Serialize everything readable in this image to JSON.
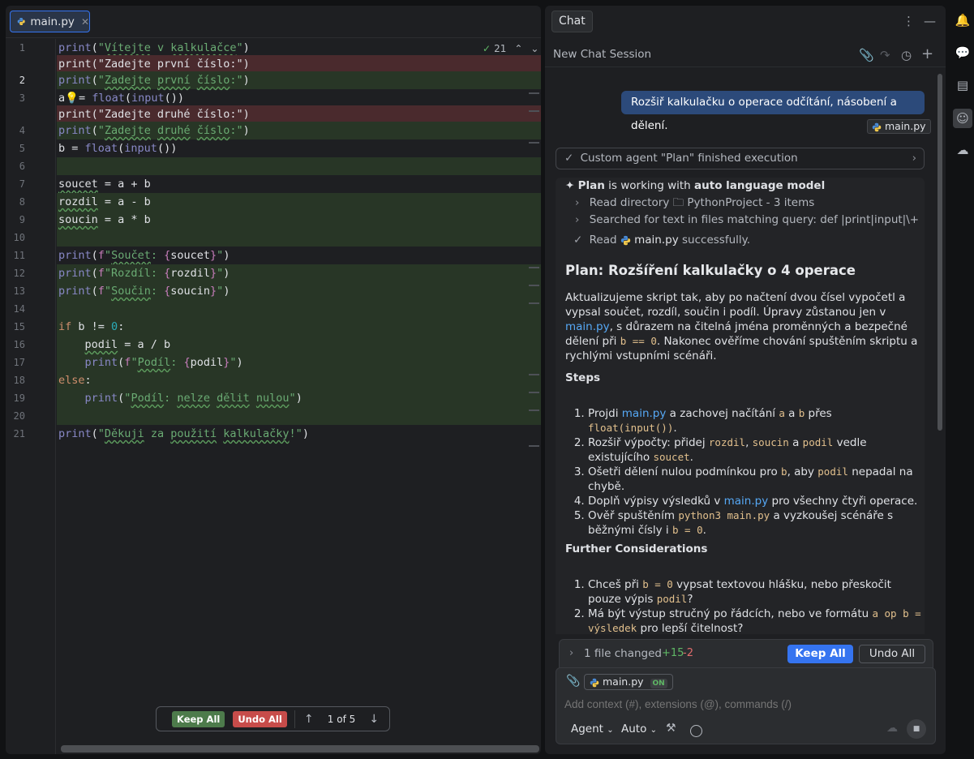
{
  "editor": {
    "tab_label": "main.py",
    "diff_count": "21",
    "line_numbers": [
      "1",
      "2",
      "3",
      "4",
      "5",
      "6",
      "7",
      "8",
      "9",
      "10",
      "11",
      "12",
      "13",
      "14",
      "15",
      "16",
      "17",
      "18",
      "19",
      "20",
      "21"
    ],
    "floating": {
      "keep_all": "Keep All",
      "undo_all": "Undo All",
      "position": "1 of 5"
    }
  },
  "chat": {
    "tab_label": "Chat",
    "session_title": "New Chat Session",
    "user_message": "Rozšiř kalkulačku o operace odčítání, násobení a dělení.",
    "user_attachment": "main.py",
    "agent_status": "Custom agent \"Plan\" finished execution",
    "plan_header": {
      "name": "Plan",
      "mid": "is working with",
      "model": "auto language model"
    },
    "tools": {
      "read_dir_label": "Read directory",
      "read_dir_target": "PythonProject - 3 items",
      "search_label": "Searched for text in files matching query: def |print|input|\\+",
      "read_label": "Read",
      "read_file": "main.py",
      "read_suffix": "successfully."
    },
    "plan_title": "Plan: Rozšíření kalkulačky o 4 operace",
    "intro": {
      "a": "Aktualizujeme skript tak, aby po načtení dvou čísel vypočetl a vypsal součet, rozdíl, součin i podíl. Úpravy zůstanou jen v ",
      "link": "main.py",
      "b": ", s důrazem na čitelná jména proměnných a bezpečné dělení při ",
      "code": "b == 0",
      "c": ". Nakonec ověříme chování spuštěním skriptu a rychlými vstupními scénáři."
    },
    "steps_heading": "Steps",
    "steps": {
      "s1": {
        "a": "Projdi ",
        "link": "main.py",
        "b": " a zachovej načítání ",
        "c1": "a",
        "b2": " a ",
        "c2": "b",
        "b3": " přes ",
        "c3": "float(input())",
        "end": "."
      },
      "s2": {
        "a": "Rozšiř výpočty: přidej ",
        "c1": "rozdil",
        "b": ", ",
        "c2": "soucin",
        "b2": " a ",
        "c3": "podil",
        "b3": " vedle existujícího ",
        "c4": "soucet",
        "end": "."
      },
      "s3": {
        "a": "Ošetři dělení nulou podmínkou pro ",
        "c1": "b",
        "b": ", aby ",
        "c2": "podil",
        "end": " nepadal na chybě."
      },
      "s4": {
        "a": "Doplň výpisy výsledků v ",
        "link": "main.py",
        "end": " pro všechny čtyři operace."
      },
      "s5": {
        "a": "Ověř spuštěním ",
        "c1": "python3 main.py",
        "b": " a vyzkoušej scénáře s běžnými čísly i ",
        "c2": "b = 0",
        "end": "."
      }
    },
    "further_heading": "Further Considerations",
    "further": {
      "f1": {
        "a": "Chceš při ",
        "c1": "b = 0",
        "b": " vypsat textovou hlášku, nebo přeskočit pouze výpis ",
        "c2": "podil",
        "end": "?"
      },
      "f2": {
        "a": "Má být výstup stručný po řádcích, nebo ve formátu ",
        "c1": "a op b = výsledek",
        "end": " pro lepší čitelnost?"
      }
    },
    "changes": {
      "summary": "1 file changed",
      "added": "+15",
      "removed": "-2",
      "keep_all": "Keep All",
      "undo_all": "Undo All"
    },
    "composer": {
      "context_file": "main.py",
      "context_toggle": "ON",
      "placeholder": "Add context (#), extensions (@), commands (/)",
      "mode": "Agent",
      "model": "Auto"
    }
  }
}
